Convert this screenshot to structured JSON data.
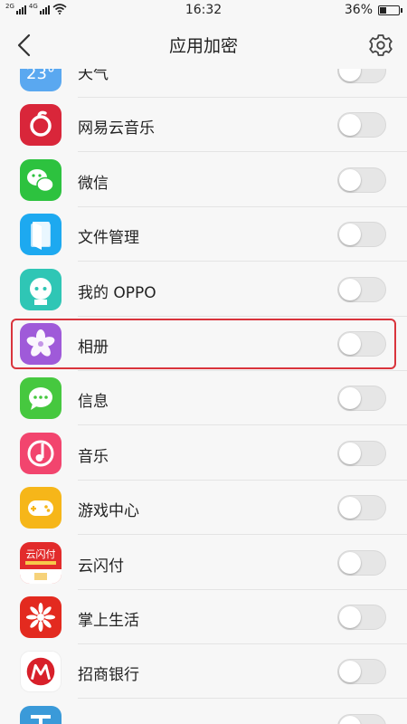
{
  "status_bar": {
    "network_1": "2G",
    "network_2": "4G",
    "time": "16:32",
    "battery_percent": "36%",
    "battery_level": 0.36
  },
  "header": {
    "title": "应用加密"
  },
  "apps": [
    {
      "name": "天气",
      "icon": "weather-icon",
      "color": "#5aa8f0",
      "enabled": false
    },
    {
      "name": "网易云音乐",
      "icon": "netease-music-icon",
      "color": "#d9263a",
      "enabled": false
    },
    {
      "name": "微信",
      "icon": "wechat-icon",
      "color": "#2dc23f",
      "enabled": false
    },
    {
      "name": "文件管理",
      "icon": "file-manager-icon",
      "color": "#1da9f0",
      "enabled": false
    },
    {
      "name": "我的 OPPO",
      "icon": "my-oppo-icon",
      "color": "#2fc6b5",
      "enabled": false
    },
    {
      "name": "相册",
      "icon": "gallery-icon",
      "color": "#9f5ad9",
      "enabled": false,
      "highlighted": true
    },
    {
      "name": "信息",
      "icon": "messages-icon",
      "color": "#46c83f",
      "enabled": false
    },
    {
      "name": "音乐",
      "icon": "music-icon",
      "color": "#f2456e",
      "enabled": false
    },
    {
      "name": "游戏中心",
      "icon": "game-center-icon",
      "color": "#f6b619",
      "enabled": false
    },
    {
      "name": "云闪付",
      "icon": "quickpass-icon",
      "color": "#e22b2b",
      "enabled": false,
      "icon_text": "云闪付"
    },
    {
      "name": "掌上生活",
      "icon": "life-icon",
      "color": "#e32a1f",
      "enabled": false
    },
    {
      "name": "招商银行",
      "icon": "cmb-icon",
      "color": "#ffffff",
      "enabled": false
    },
    {
      "name": "",
      "icon": "partial-app-icon",
      "color": "#3a9ad9",
      "enabled": false
    }
  ]
}
